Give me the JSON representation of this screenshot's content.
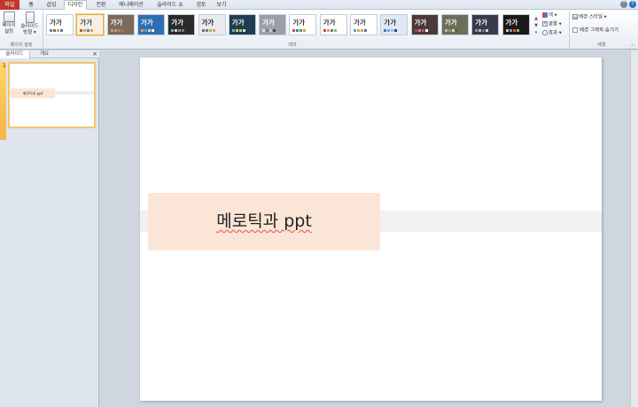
{
  "tabs": {
    "file": "파일",
    "home": "홈",
    "insert": "삽입",
    "design": "디자인",
    "transitions": "전환",
    "animations": "애니메이션",
    "slideshow": "슬라이드 쇼",
    "review": "검토",
    "view": "보기"
  },
  "ribbon": {
    "page_setup_label": "페이지\n설정",
    "orientation_label": "슬라이드\n방향 ▾",
    "page_setup_group": "페이지 설정",
    "themes_group": "테마",
    "background_group": "배경",
    "theme_sample_text": "가가",
    "colors_label": "색 ▾",
    "fonts_label": "글꼴 ▾",
    "effects_label": "효과 ▾",
    "bg_styles_label": "배경 스타일 ▾",
    "hide_bg_label": "배경 그래픽 숨기기",
    "themes": [
      {
        "bg": "#ffffff",
        "fg": "#333333",
        "accent": [
          "#4f81bd",
          "#c0504d",
          "#9bbb59",
          "#8064a2"
        ]
      },
      {
        "bg": "#f5f0e6",
        "fg": "#444444",
        "accent": [
          "#c0504d",
          "#9bbb59",
          "#4f81bd",
          "#f79646"
        ]
      },
      {
        "bg": "#7a6a5c",
        "fg": "#ffffff",
        "accent": [
          "#d99a5b",
          "#c1a27a",
          "#9c8b6c",
          "#b86b4b"
        ]
      },
      {
        "bg": "#2c6fb2",
        "fg": "#ffffff",
        "accent": [
          "#e8a33b",
          "#5fa3d8",
          "#f2d06b",
          "#ffffff"
        ]
      },
      {
        "bg": "#2a2a2a",
        "fg": "#ffffff",
        "accent": [
          "#6aa9d6",
          "#d0d0d0",
          "#8a8a8a",
          "#5c7fa3"
        ]
      },
      {
        "bg": "#e8ecef",
        "fg": "#222222",
        "accent": [
          "#c0504d",
          "#4f81bd",
          "#9bbb59",
          "#f79646"
        ]
      },
      {
        "bg": "#1f3e4f",
        "fg": "#ffffff",
        "accent": [
          "#5ab4c5",
          "#f0c05a",
          "#a0d07a",
          "#e0e0e0"
        ]
      },
      {
        "bg": "#9aa0a8",
        "fg": "#ffffff",
        "accent": [
          "#e0e0e0",
          "#70808c",
          "#c0c8d0",
          "#404850"
        ]
      },
      {
        "bg": "#ffffff",
        "fg": "#333333",
        "accent": [
          "#d04a3a",
          "#3a7ac0",
          "#5a9a40",
          "#e0a030"
        ]
      },
      {
        "bg": "#ffffff",
        "fg": "#333333",
        "accent": [
          "#c0504d",
          "#f79646",
          "#4f81bd",
          "#9bbb59"
        ]
      },
      {
        "bg": "#ffffff",
        "fg": "#333333",
        "accent": [
          "#4bacc6",
          "#f79646",
          "#9bbb59",
          "#8064a2"
        ]
      },
      {
        "bg": "#dfe9f5",
        "fg": "#333333",
        "accent": [
          "#3a78c0",
          "#6fa8dc",
          "#9fc5e8",
          "#1f4e79"
        ]
      },
      {
        "bg": "#4a3a3a",
        "fg": "#ffffff",
        "accent": [
          "#c04040",
          "#e08080",
          "#a06060",
          "#ffffff"
        ]
      },
      {
        "bg": "#6b6e5a",
        "fg": "#ffffff",
        "accent": [
          "#b8c090",
          "#8a9a6a",
          "#d0d8b0",
          "#5a6040"
        ]
      },
      {
        "bg": "#3a3a4a",
        "fg": "#ffffff",
        "accent": [
          "#8090c0",
          "#b0b8e0",
          "#6070a0",
          "#d0d0e0"
        ]
      },
      {
        "bg": "#1a1a1a",
        "fg": "#ffffff",
        "accent": [
          "#f0c040",
          "#4fa0e0",
          "#e05050",
          "#80c060"
        ]
      }
    ]
  },
  "pane": {
    "tab_slides": "슬라이드",
    "tab_outline": "개요",
    "close": "×",
    "slide_number": "1",
    "thumb_title": "메로틱과 ppt"
  },
  "slide": {
    "title": "메로틱과 ppt"
  },
  "colors": {
    "file_tab": "#c0392b",
    "title_fill": "#fbe5d6",
    "band": "#f1f1f1",
    "selected_thumb": "#f2c56a"
  }
}
